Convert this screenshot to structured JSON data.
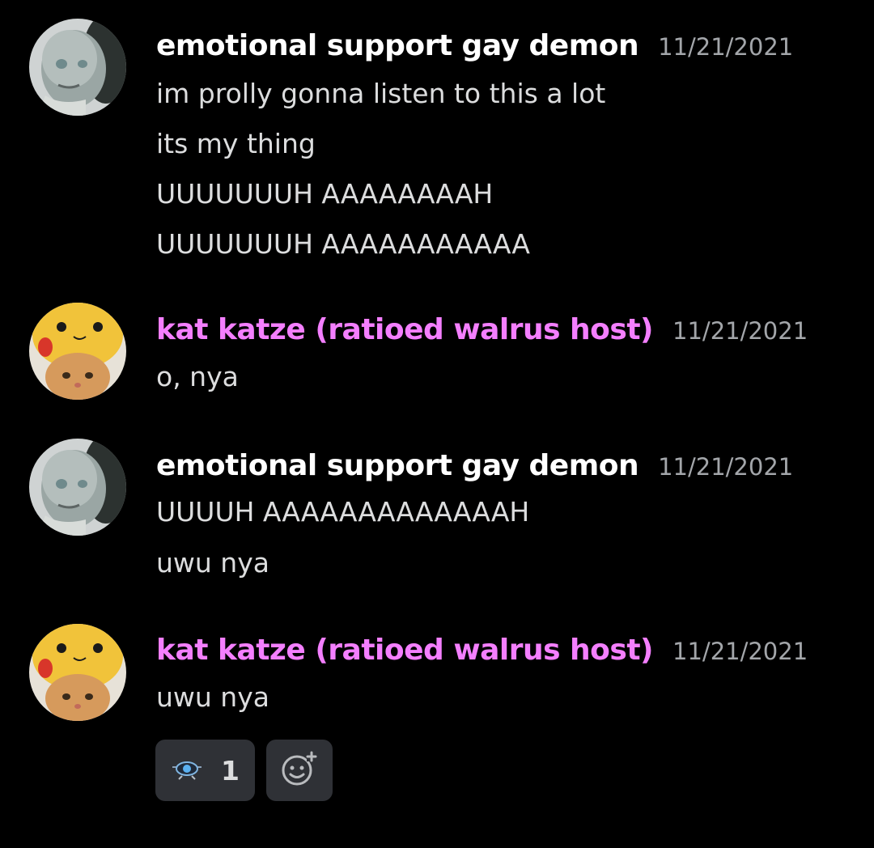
{
  "colors": {
    "background": "#000000",
    "user1_name": "#ffffff",
    "user2_name": "#f47fff",
    "timestamp": "#a3a6aa",
    "message_text": "#dcddde",
    "reaction_bg": "#2f3136"
  },
  "messages": [
    {
      "username": "emotional support gay demon",
      "timestamp": "11/21/2021",
      "avatar": "bald-face-avatar",
      "lines": [
        "im prolly gonna listen to this a lot",
        "its my thing",
        "UUUUUUUH AAAAAAAAH",
        "UUUUUUUH AAAAAAAAAAA"
      ]
    },
    {
      "username": "kat katze (ratioed walrus host)",
      "timestamp": "11/21/2021",
      "avatar": "cat-pikachu-hat-avatar",
      "lines": [
        "o, nya"
      ]
    },
    {
      "username": "emotional support gay demon",
      "timestamp": "11/21/2021",
      "avatar": "bald-face-avatar",
      "lines": [
        "UUUUH AAAAAAAAAAAAAH",
        "uwu nya"
      ]
    },
    {
      "username": "kat katze (ratioed walrus host)",
      "timestamp": "11/21/2021",
      "avatar": "cat-pikachu-hat-avatar",
      "lines": [
        "uwu nya"
      ]
    }
  ],
  "reactions": [
    {
      "emoji": "ufo-emoji-icon",
      "count": "1"
    }
  ],
  "add_reaction_icon": "add-reaction-icon"
}
